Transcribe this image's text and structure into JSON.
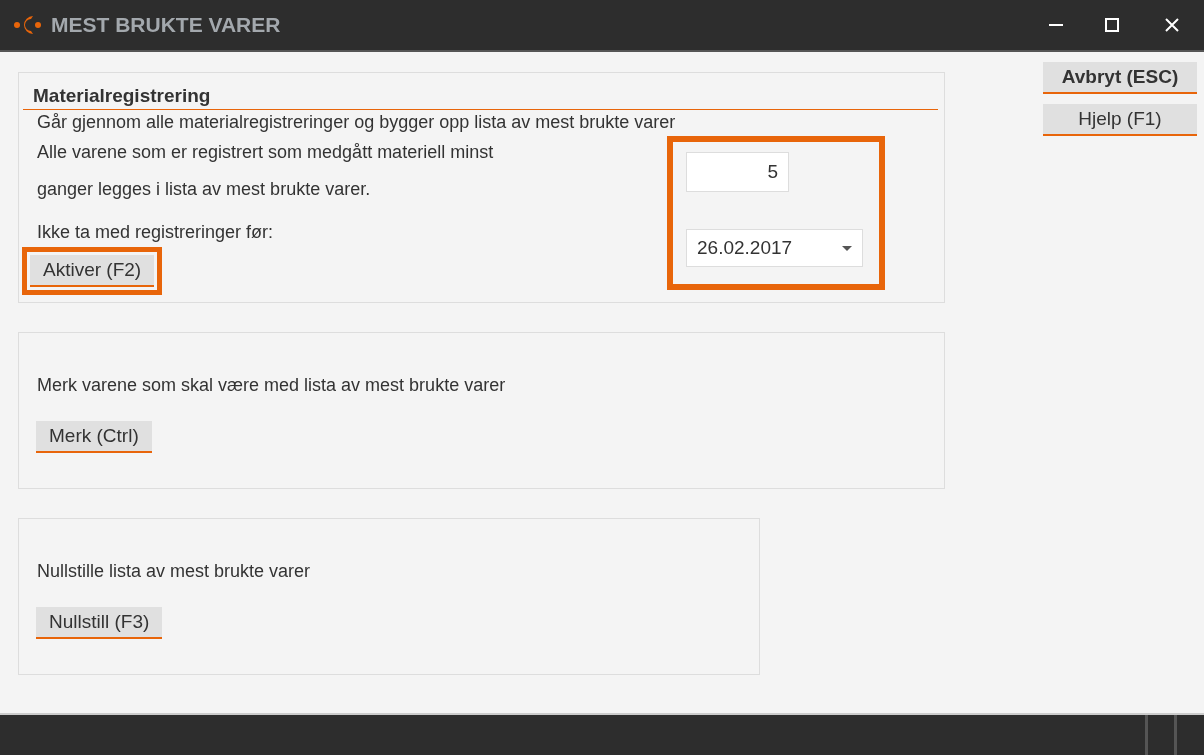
{
  "window": {
    "title": "MEST BRUKTE VARER"
  },
  "side_buttons": [
    {
      "label": "Avbryt (ESC)",
      "default": true
    },
    {
      "label": "Hjelp (F1)",
      "default": false
    }
  ],
  "sections": [
    {
      "heading": "Materialregistrering",
      "intro": "Går gjennom alle materialregistreringer og bygger opp lista av mest brukte varer",
      "lines": [
        "Alle varene som er registrert som medgått materiell minst",
        "ganger legges i lista av mest brukte varer.",
        "Ikke ta med registreringer før:"
      ],
      "fields": {
        "highlighted": true,
        "count": "5",
        "date": "26.02.2017"
      },
      "button": {
        "label": "Aktiver (F2)",
        "highlighted": true
      }
    },
    {
      "lines": [
        "Merk varene som skal være med lista av mest brukte varer"
      ],
      "button": {
        "label": "Merk (Ctrl)",
        "highlighted": false
      }
    },
    {
      "lines": [
        "Nullstille lista av mest brukte varer"
      ],
      "button": {
        "label": "Nullstill (F3)",
        "highlighted": false
      }
    }
  ]
}
